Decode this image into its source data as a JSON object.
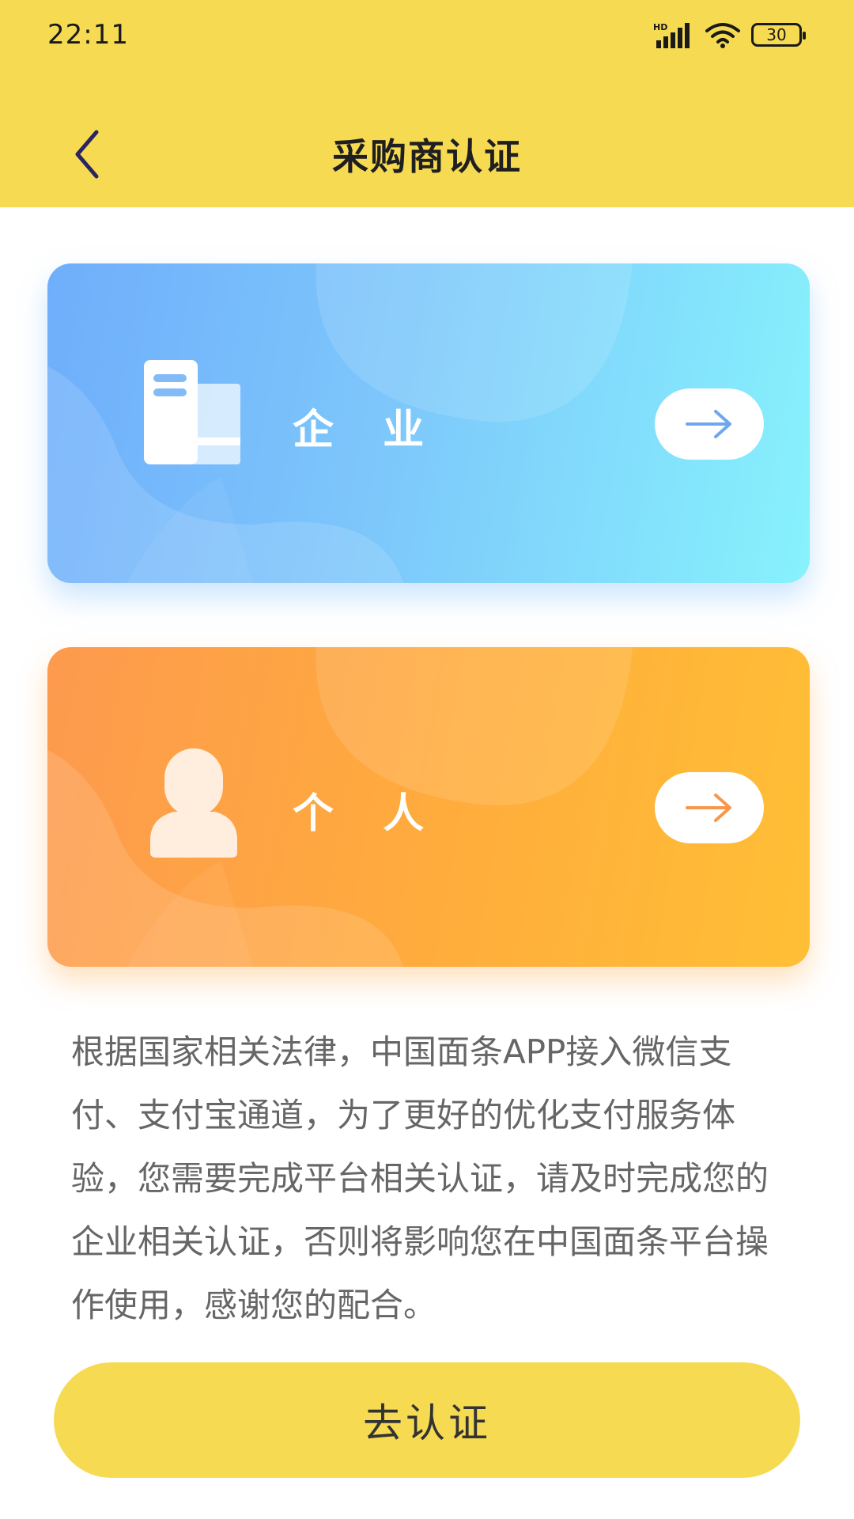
{
  "status_bar": {
    "time": "22:11",
    "network_label": "HD",
    "battery_level": "30"
  },
  "header": {
    "title": "采购商认证",
    "back_icon": "chevron-left-icon"
  },
  "cards": {
    "enterprise": {
      "label": "企 业",
      "icon": "building-icon",
      "arrow_icon": "arrow-right-icon"
    },
    "personal": {
      "label": "个 人",
      "icon": "person-icon",
      "arrow_icon": "arrow-right-icon"
    }
  },
  "description": "根据国家相关法律，中国面条APP接入微信支付、支付宝通道，为了更好的优化支付服务体验，您需要完成平台相关认证，请及时完成您的企业相关认证，否则将影响您在中国面条平台操作使用，感谢您的配合。",
  "submit_button": {
    "label": "去认证"
  },
  "colors": {
    "header_bg": "#F6DA52",
    "enterprise_gradient": [
      "#6FAEFB",
      "#87F2FC"
    ],
    "personal_gradient": [
      "#FD9A4E",
      "#FFBF35"
    ],
    "enterprise_arrow": "#6FA7EE",
    "personal_arrow": "#F8974A",
    "button_bg": "#F6DA52"
  }
}
